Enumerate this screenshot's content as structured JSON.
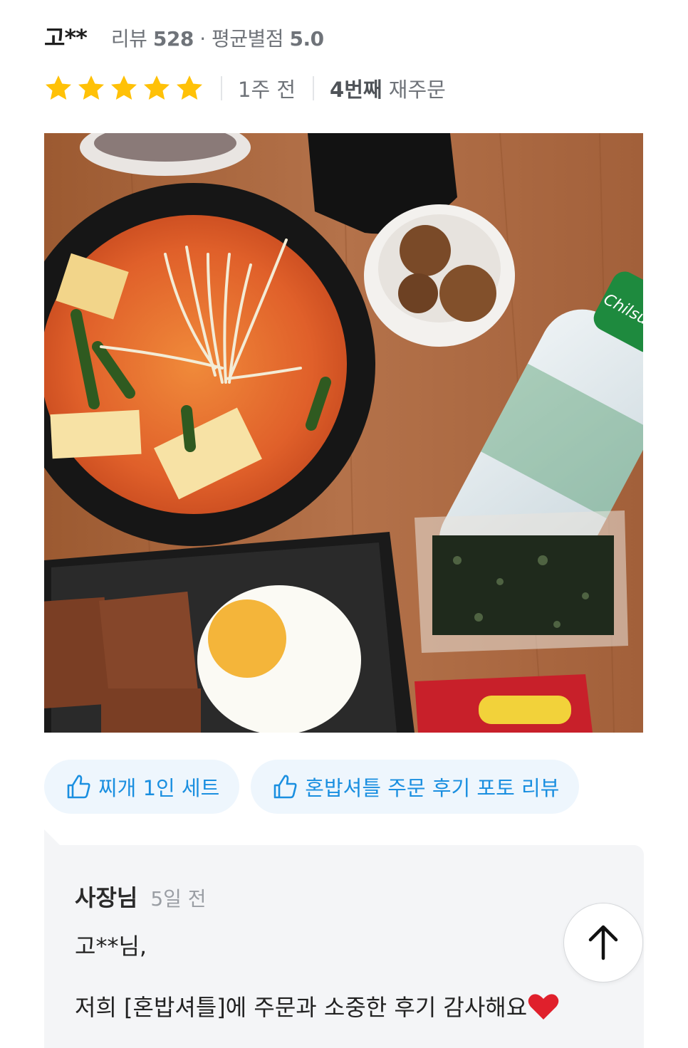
{
  "review": {
    "reviewer_name": "고**",
    "stats_prefix": "리뷰",
    "review_count": "528",
    "stats_middle": "· 평균별점",
    "avg_rating": "5.0",
    "rating": 5,
    "rating_max": 5,
    "time_ago": "1주 전",
    "reorder_count": "4번째",
    "reorder_suffix": "재주문",
    "photo_icon": "food-photo",
    "tags": [
      {
        "label": "찌개 1인 세트",
        "icon": "thumbs-up-icon"
      },
      {
        "label": "혼밥셔틀 주문 후기 포토 리뷰",
        "icon": "thumbs-up-icon"
      }
    ]
  },
  "owner_reply": {
    "name": "사장님",
    "time_ago": "5일 전",
    "greeting": "고**님,",
    "message": "저희 [혼밥셔틀]에 주문과 소중한 후기 감사해요",
    "emoji": "red-heart-icon"
  },
  "scroll_button": {
    "icon": "arrow-up-icon"
  },
  "colors": {
    "star": "#FFC107",
    "chip_bg": "#EEF6FD",
    "chip_text": "#1A8FE0",
    "reply_bg": "#F4F5F7",
    "heart": "#E0202C"
  }
}
